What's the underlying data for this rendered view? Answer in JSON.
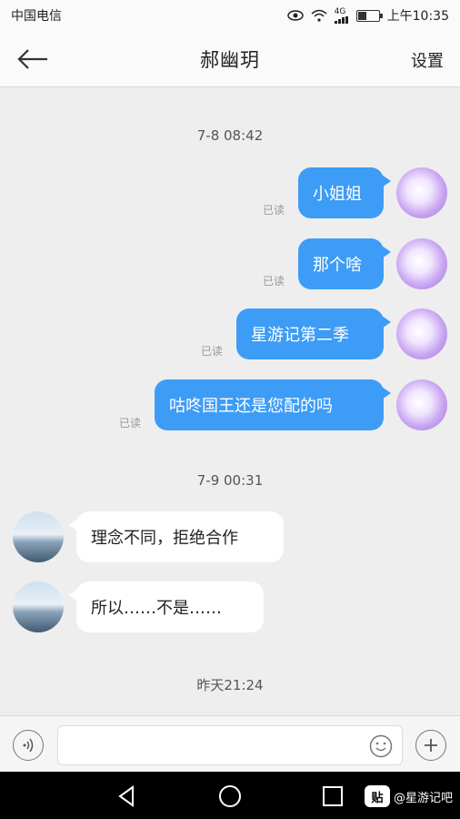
{
  "status_bar": {
    "carrier": "中国电信",
    "network": "4G",
    "time": "上午10:35",
    "battery_level": 0.4
  },
  "header": {
    "title": "郝幽玥",
    "settings_label": "设置"
  },
  "chat": {
    "timestamps": [
      "7-8 08:42",
      "7-9 00:31",
      "昨天21:24"
    ],
    "sent_messages": [
      {
        "text": "小姐姐",
        "status": "已读"
      },
      {
        "text": "那个啥",
        "status": "已读"
      },
      {
        "text": "星游记第二季",
        "status": "已读"
      },
      {
        "text": "咕咚国王还是您配的吗",
        "status": "已读"
      }
    ],
    "received_messages": [
      {
        "text": "理念不同，拒绝合作"
      },
      {
        "text": "所以……不是……"
      }
    ]
  },
  "input_bar": {
    "placeholder": ""
  },
  "watermark": {
    "badge": "贴",
    "text": "@星游记吧"
  }
}
